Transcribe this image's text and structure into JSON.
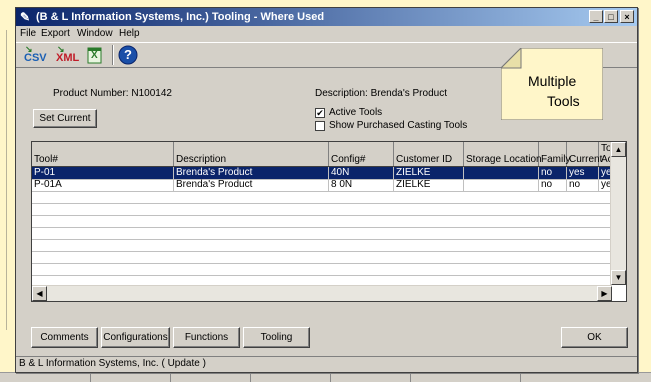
{
  "window": {
    "title": "(B & L Information Systems, Inc.) Tooling - Where Used",
    "minimize": "_",
    "maximize": "□",
    "close": "×"
  },
  "menu": [
    "File",
    "Export",
    "Window",
    "Help"
  ],
  "toolbar": {
    "csv": "CSV",
    "xml": "XML",
    "excel": "X",
    "help": "?"
  },
  "callout": {
    "text_line1": "Multiple",
    "text_line2": "Tools"
  },
  "product": {
    "number_label": "Product Number: N100142",
    "description_label": "Description: Brenda's Product"
  },
  "set_current_label": "Set Current",
  "filters": {
    "active_tools_label": "Active Tools",
    "active_tools_checked": "✔",
    "show_purchased_label": "Show Purchased Casting Tools"
  },
  "grid": {
    "columns": [
      "Tool#",
      "Description",
      "Config#",
      "Customer ID",
      "Storage Location",
      "Family",
      "Current",
      "Tool Active"
    ],
    "rows": [
      [
        "P-01",
        "Brenda's Product",
        "40N",
        "ZIELKE",
        "",
        "no",
        "yes",
        "yes"
      ],
      [
        "P-01A",
        "Brenda's Product",
        "8 0N",
        "ZIELKE",
        "",
        "no",
        "no",
        "yes"
      ]
    ]
  },
  "buttons": {
    "comments": "Comments",
    "configurations": "Configurations",
    "functions": "Functions",
    "tooling": "Tooling",
    "ok": "OK"
  },
  "statusbar": "B & L Information Systems, Inc.    ( Update )",
  "colors": {
    "title_start": "#0a246a",
    "title_end": "#a6caf0",
    "selection": "#0a246a",
    "note_fill": "#fff6c9",
    "window_face": "#d4d0c8"
  }
}
